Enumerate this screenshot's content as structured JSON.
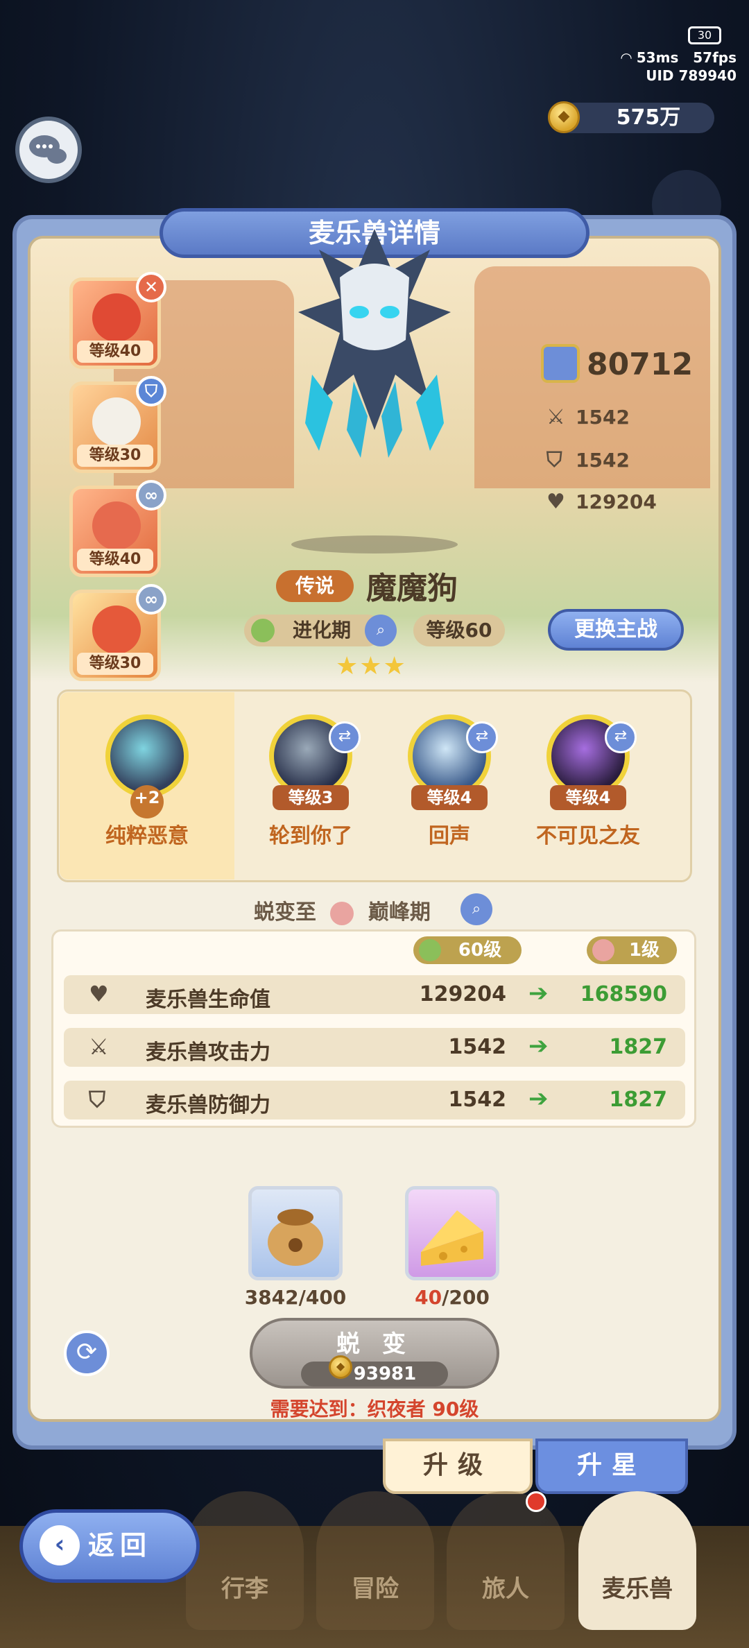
{
  "status": {
    "battery": "30",
    "ping": "53ms",
    "fps": "57fps",
    "uid": "UID  789940"
  },
  "currency": {
    "coins": "575万"
  },
  "panel": {
    "title": "麦乐兽详情"
  },
  "skill_cards": [
    {
      "level": "等级40",
      "badge": "cross"
    },
    {
      "level": "等级30",
      "badge": "shield"
    },
    {
      "level": "等级40",
      "badge": "link"
    },
    {
      "level": "等级30",
      "badge": "link"
    }
  ],
  "stats": {
    "power": "80712",
    "attack": "1542",
    "defense": "1542",
    "hp": "129204"
  },
  "pet": {
    "rarity": "传说",
    "name": "魔魔狗",
    "stage": "进化期",
    "level": "等级60",
    "swap_label": "更换主战",
    "stars": "★★★"
  },
  "evo_skills": [
    {
      "name": "纯粹恶意",
      "level": "+2"
    },
    {
      "name": "轮到你了",
      "level": "等级3"
    },
    {
      "name": "回声",
      "level": "等级4"
    },
    {
      "name": "不可见之友",
      "level": "等级4"
    }
  ],
  "metamorph": {
    "prefix": "蜕变至",
    "target_stage": "巅峰期",
    "from_level": "60级",
    "to_level": "1级",
    "rows": [
      {
        "label": "麦乐兽生命值",
        "old": "129204",
        "new": "168590"
      },
      {
        "label": "麦乐兽攻击力",
        "old": "1542",
        "new": "1827"
      },
      {
        "label": "麦乐兽防御力",
        "old": "1542",
        "new": "1827"
      }
    ]
  },
  "materials": [
    {
      "name": "food-bag",
      "count": "3842/400"
    },
    {
      "name": "cheese",
      "have": "40",
      "need": "/200"
    }
  ],
  "action": {
    "label": "蜕 变",
    "cost": "93981",
    "requirement": "需要达到：织夜者 90级"
  },
  "tabs": {
    "upgrade": "升级",
    "star": "升星"
  },
  "back": "返回",
  "nav": [
    "行李",
    "冒险",
    "旅人",
    "麦乐兽"
  ],
  "colors": {
    "accent": "#6c8fe0",
    "legend": "#c8702f",
    "increase": "#3c9c34",
    "warning": "#d4452d"
  }
}
